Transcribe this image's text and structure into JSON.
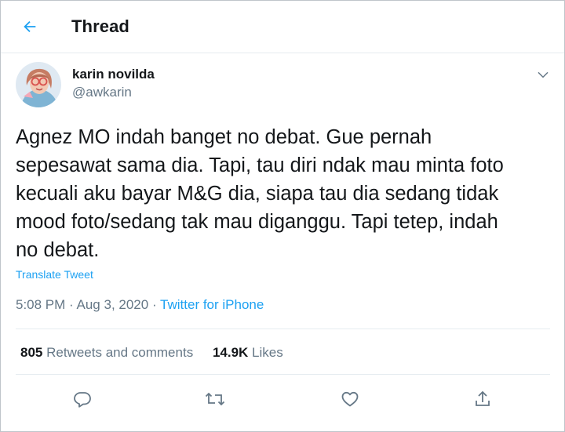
{
  "header": {
    "title": "Thread",
    "back_icon": "arrow-left-icon"
  },
  "author": {
    "name": "karin novilda",
    "handle": "@awkarin",
    "avatar": "avatar"
  },
  "tweet": {
    "text": "Agnez MO indah banget no debat. Gue pernah\nsepesawat sama dia. Tapi, tau diri ndak mau minta foto\nkecuali aku bayar M&G dia, siapa tau dia sedang tidak\nmood foto/sedang tak mau diganggu. Tapi tetep, indah\nno debat.",
    "translate_label": "Translate Tweet"
  },
  "meta": {
    "time": "5:08 PM",
    "separator": "·",
    "date": "Aug 3, 2020",
    "source": "Twitter for iPhone"
  },
  "stats": {
    "retweets_count": "805",
    "retweets_label": "Retweets and comments",
    "likes_count": "14.9K",
    "likes_label": "Likes"
  },
  "actions": [
    "reply-icon",
    "retweet-icon",
    "like-icon",
    "share-icon"
  ],
  "colors": {
    "accent": "#1da1f2",
    "text": "#14171a",
    "secondary": "#657786",
    "border": "#e6ecf0"
  }
}
